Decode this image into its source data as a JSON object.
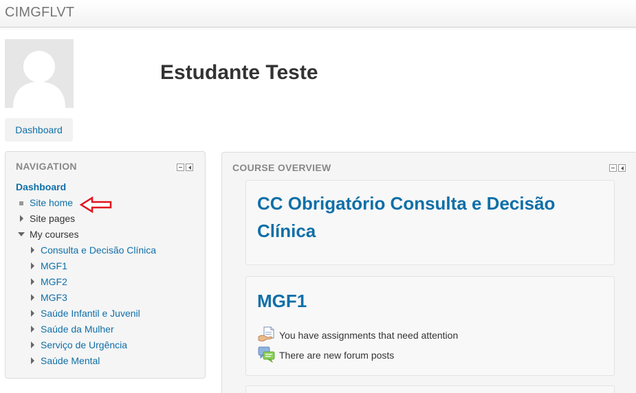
{
  "site": {
    "name": "CIMGFLVT"
  },
  "user": {
    "full_name": "Estudante Teste"
  },
  "header": {
    "dashboard_button": "Dashboard"
  },
  "navigation": {
    "title": "NAVIGATION",
    "root": "Dashboard",
    "site_home": "Site home",
    "site_pages": "Site pages",
    "my_courses": "My courses",
    "courses": [
      "Consulta e Decisão Clínica",
      "MGF1",
      "MGF2",
      "MGF3",
      "Saúde Infantil e Juvenil",
      "Saúde da Mulher",
      "Serviço de Urgência",
      "Saúde Mental"
    ]
  },
  "course_overview": {
    "title": "COURSE OVERVIEW",
    "cards": [
      {
        "title": "CC Obrigatório Consulta e Decisão Clínica"
      },
      {
        "title": "MGF1",
        "notices": [
          {
            "icon": "assignment-icon",
            "text": "You have assignments that need attention"
          },
          {
            "icon": "forum-icon",
            "text": "There are new forum posts"
          }
        ]
      }
    ]
  },
  "colors": {
    "link": "#0f6fa8",
    "annotation_arrow": "#e0141e"
  }
}
